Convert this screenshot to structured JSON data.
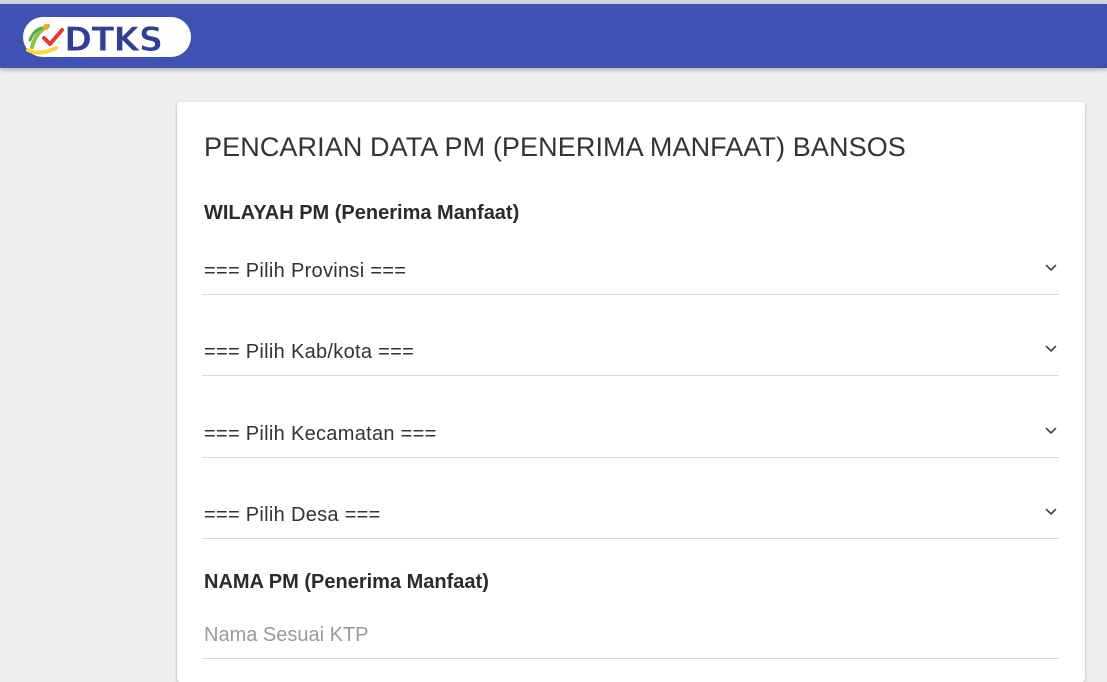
{
  "header": {
    "logo_text": "DTKS",
    "background_color": "#3f51b5"
  },
  "form": {
    "title": "PENCARIAN DATA PM (PENERIMA MANFAAT) BANSOS",
    "wilayah_label": "WILAYAH PM (Penerima Manfaat)",
    "selects": [
      {
        "selected": "=== Pilih Provinsi ==="
      },
      {
        "selected": "=== Pilih Kab/kota ==="
      },
      {
        "selected": "=== Pilih Kecamatan ==="
      },
      {
        "selected": "=== Pilih Desa ==="
      }
    ],
    "nama_label": "NAMA PM (Penerima Manfaat)",
    "nama_input": {
      "value": "",
      "placeholder": "Nama Sesuai KTP"
    }
  },
  "icons": [
    "dtks-logo-icon",
    "chevron-down-icon"
  ]
}
